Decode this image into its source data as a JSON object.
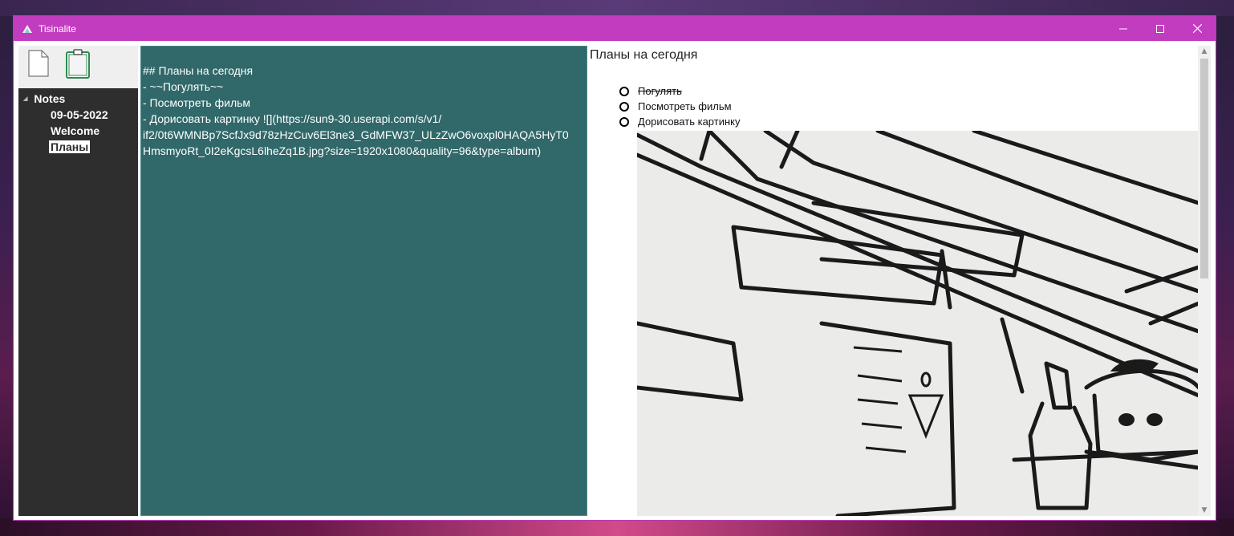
{
  "window": {
    "title": "Tisinalite"
  },
  "toolbar": {
    "new_icon": "new-file-icon",
    "paste_icon": "clipboard-icon"
  },
  "tree": {
    "root_label": "Notes",
    "items": [
      {
        "label": "09-05-2022"
      },
      {
        "label": "Welcome"
      },
      {
        "label": "Планы",
        "selected": true
      }
    ]
  },
  "editor": {
    "lines": [
      "## Планы на сегодня",
      "- ~~Погулять~~",
      "- Посмотреть фильм",
      "- Дорисовать картинку ![](https://sun9-30.userapi.com/s/v1/",
      "if2/0t6WMNBp7ScfJx9d78zHzCuv6El3ne3_GdMFW37_ULzZwO6voxpl0HAQA5HyT0",
      "HmsmyoRt_0I2eKgcsL6lheZq1B.jpg?size=1920x1080&quality=96&type=album)"
    ]
  },
  "preview": {
    "heading": "Планы на сегодня",
    "todos": [
      {
        "text": "Погулять",
        "done": true
      },
      {
        "text": "Посмотреть фильм",
        "done": false
      },
      {
        "text": "Дорисовать картинку",
        "done": false
      }
    ]
  },
  "colors": {
    "titlebar": "#c23cbf",
    "tree_bg": "#2e2e2e",
    "editor_bg": "#31686a"
  }
}
